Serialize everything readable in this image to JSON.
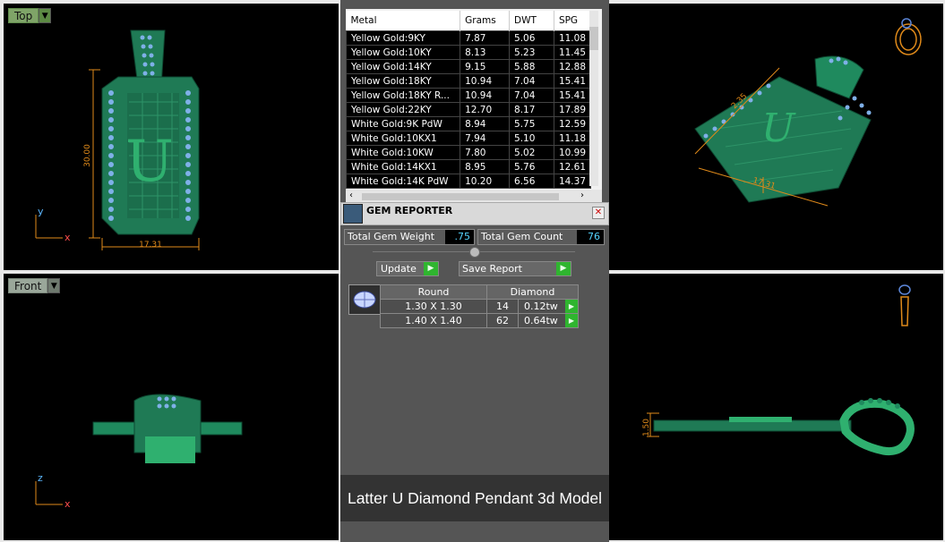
{
  "viewports": {
    "top": {
      "label": "Top",
      "axis_y": "y",
      "axis_x": "x",
      "dim_height": "30.00",
      "dim_width": "17.31",
      "letter": "U"
    },
    "front": {
      "label": "Front",
      "axis_y": "z",
      "axis_x": "x"
    },
    "perspective": {
      "dim_a": "2.35",
      "dim_b": "17.31"
    },
    "right": {
      "dim": "1.50"
    }
  },
  "metal_table": {
    "headers": [
      "Metal",
      "Grams",
      "DWT",
      "SPG"
    ],
    "rows": [
      [
        "Yellow Gold:9KY",
        "7.87",
        "5.06",
        "11.08"
      ],
      [
        "Yellow Gold:10KY",
        "8.13",
        "5.23",
        "11.45"
      ],
      [
        "Yellow Gold:14KY",
        "9.15",
        "5.88",
        "12.88"
      ],
      [
        "Yellow Gold:18KY",
        "10.94",
        "7.04",
        "15.41"
      ],
      [
        "Yellow Gold:18KY R...",
        "10.94",
        "7.04",
        "15.41"
      ],
      [
        "Yellow Gold:22KY",
        "12.70",
        "8.17",
        "17.89"
      ],
      [
        "White Gold:9K PdW",
        "8.94",
        "5.75",
        "12.59"
      ],
      [
        "White Gold:10KX1",
        "7.94",
        "5.10",
        "11.18"
      ],
      [
        "White Gold:10KW",
        "7.80",
        "5.02",
        "10.99"
      ],
      [
        "White Gold:14KX1",
        "8.95",
        "5.76",
        "12.61"
      ],
      [
        "White Gold:14K PdW",
        "10.20",
        "6.56",
        "14.37"
      ]
    ]
  },
  "gem_reporter": {
    "title": "GEM REPORTER",
    "total_weight_label": "Total Gem Weight",
    "total_weight_value": ".75",
    "total_count_label": "Total Gem Count",
    "total_count_value": "76",
    "update_label": "Update",
    "save_label": "Save Report",
    "table_header": [
      "Round",
      "Diamond"
    ],
    "rows": [
      {
        "size": "1.30 X 1.30",
        "count": "14",
        "weight": "0.12tw"
      },
      {
        "size": "1.40 X 1.40",
        "count": "62",
        "weight": "0.64tw"
      }
    ]
  },
  "banner": "Latter U Diamond Pendant 3d Model",
  "colors": {
    "metal": "#1f7a55",
    "gem": "#6fa3d8",
    "dim_line": "#e08a1a"
  }
}
